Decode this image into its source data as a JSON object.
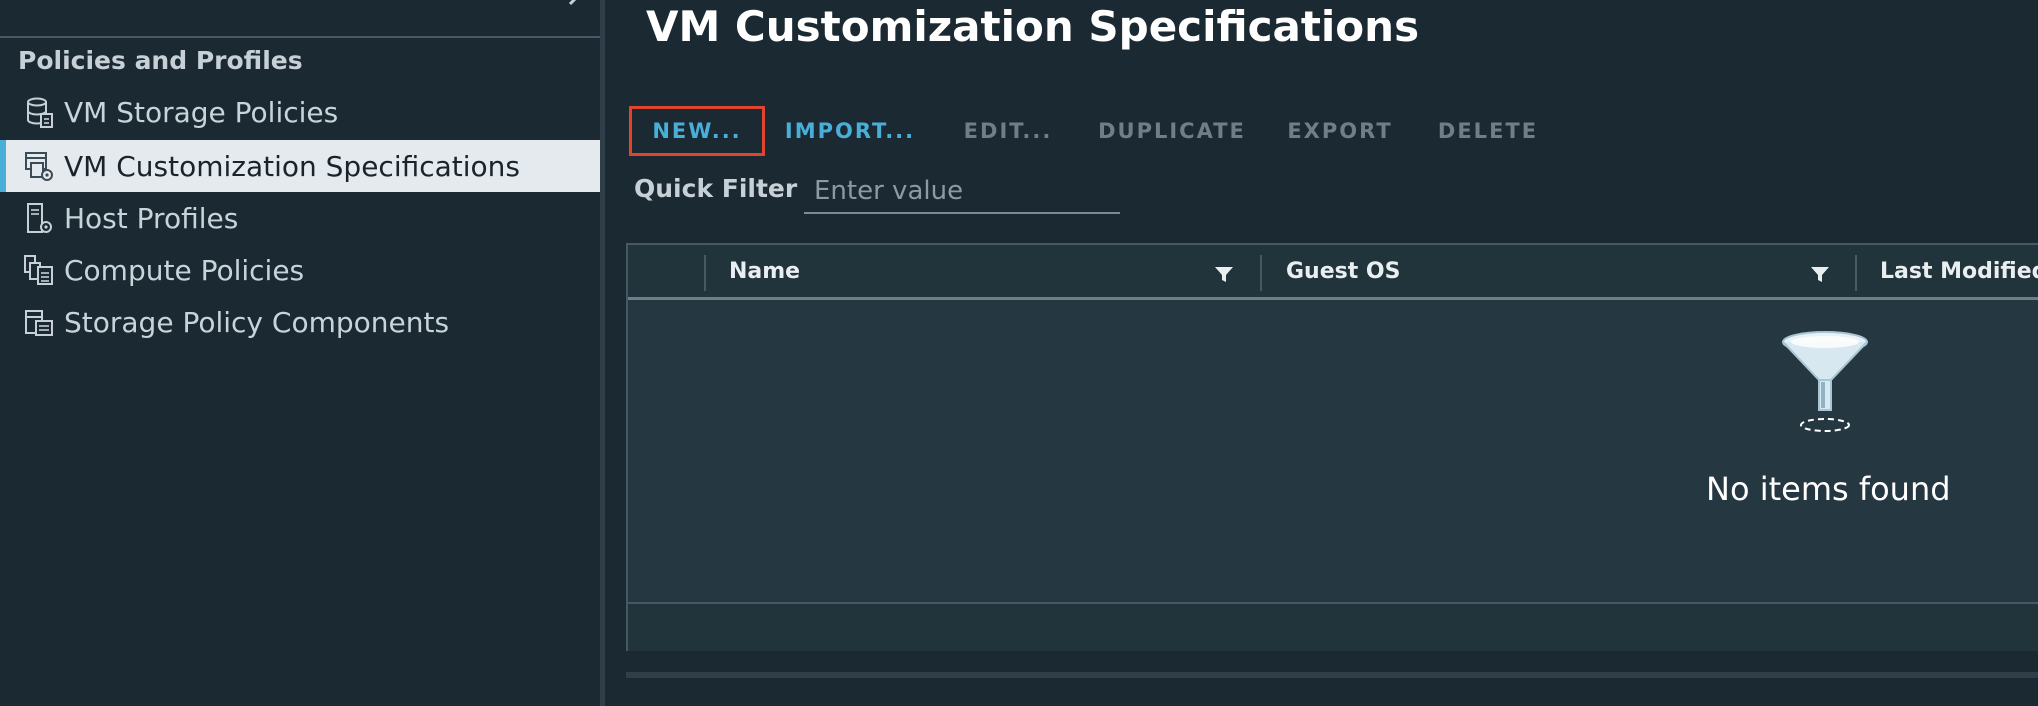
{
  "sidebar": {
    "heading": "Policies and Profiles",
    "items": [
      {
        "label": "VM Storage Policies",
        "icon": "storage-policy-icon",
        "selected": false
      },
      {
        "label": "VM Customization Specifications",
        "icon": "customization-spec-icon",
        "selected": true
      },
      {
        "label": "Host Profiles",
        "icon": "host-profile-icon",
        "selected": false
      },
      {
        "label": "Compute Policies",
        "icon": "compute-policy-icon",
        "selected": false
      },
      {
        "label": "Storage Policy Components",
        "icon": "storage-component-icon",
        "selected": false
      }
    ]
  },
  "main": {
    "title": "VM Customization Specifications",
    "toolbar": {
      "new": "NEW...",
      "import": "IMPORT...",
      "edit": "EDIT...",
      "duplicate": "DUPLICATE",
      "export": "EXPORT",
      "delete": "DELETE"
    },
    "quick_filter": {
      "label": "Quick Filter",
      "placeholder": "Enter value",
      "value": ""
    },
    "grid": {
      "columns": [
        "Name",
        "Guest OS",
        "Last Modified"
      ],
      "rows": [],
      "empty_message": "No items found"
    }
  },
  "colors": {
    "accent": "#49afd9",
    "focus_outline": "#e0442c",
    "background": "#1b2a32"
  }
}
